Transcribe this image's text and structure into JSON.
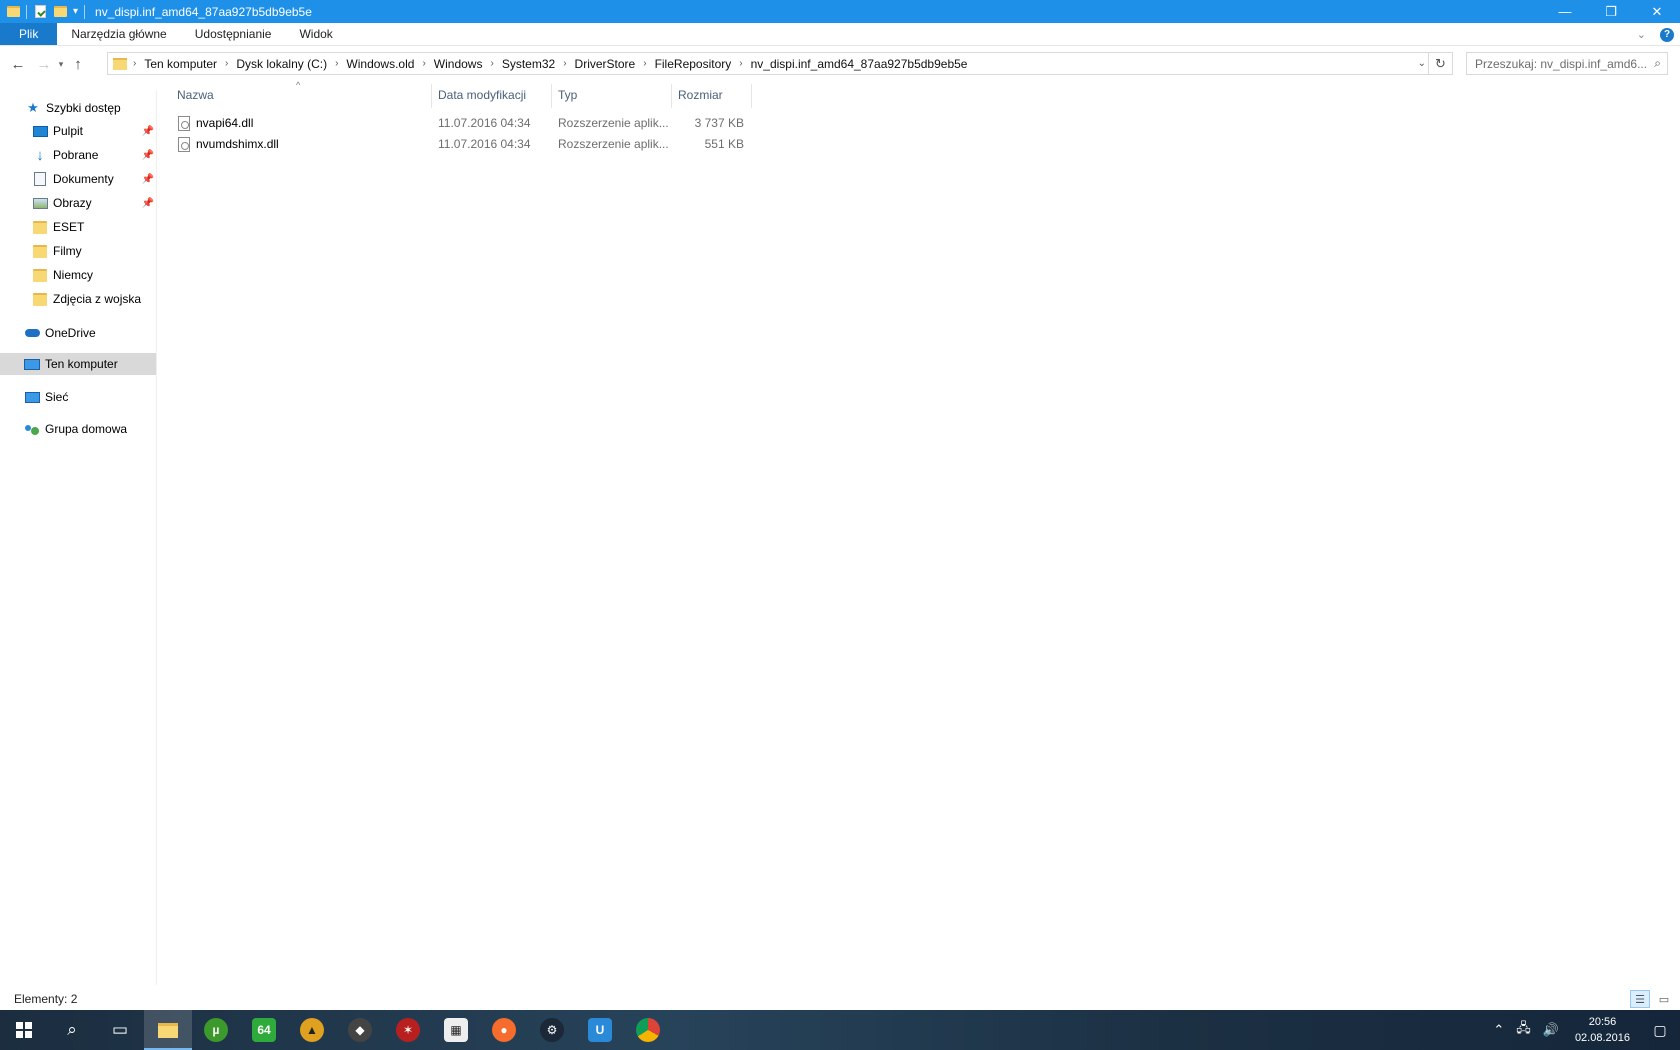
{
  "window": {
    "title": "nv_dispi.inf_amd64_87aa927b5db9eb5e",
    "minimize": "—",
    "restore": "❐",
    "close": "✕"
  },
  "ribbon": {
    "tabs": [
      "Plik",
      "Narzędzia główne",
      "Udostępnianie",
      "Widok"
    ],
    "help": "?"
  },
  "address": {
    "crumbs": [
      "Ten komputer",
      "Dysk lokalny (C:)",
      "Windows.old",
      "Windows",
      "System32",
      "DriverStore",
      "FileRepository",
      "nv_dispi.inf_amd64_87aa927b5db9eb5e"
    ],
    "search_placeholder": "Przeszukaj: nv_dispi.inf_amd6..."
  },
  "sidebar": {
    "quick_access": "Szybki dostęp",
    "items": [
      {
        "label": "Pulpit",
        "icon": "desktop-icon",
        "pinned": true
      },
      {
        "label": "Pobrane",
        "icon": "download-icon",
        "pinned": true
      },
      {
        "label": "Dokumenty",
        "icon": "documents-icon",
        "pinned": true
      },
      {
        "label": "Obrazy",
        "icon": "pictures-icon",
        "pinned": true
      },
      {
        "label": "ESET",
        "icon": "folder-icon",
        "pinned": false
      },
      {
        "label": "Filmy",
        "icon": "folder-icon",
        "pinned": false
      },
      {
        "label": "Niemcy",
        "icon": "folder-icon",
        "pinned": false
      },
      {
        "label": "Zdjęcia z wojska",
        "icon": "folder-icon",
        "pinned": false
      }
    ],
    "onedrive": "OneDrive",
    "this_pc": "Ten komputer",
    "network": "Sieć",
    "homegroup": "Grupa domowa"
  },
  "filelist": {
    "columns": [
      "Nazwa",
      "Data modyfikacji",
      "Typ",
      "Rozmiar"
    ],
    "rows": [
      {
        "name": "nvapi64.dll",
        "date": "11.07.2016 04:34",
        "type": "Rozszerzenie aplik...",
        "size": "3 737 KB"
      },
      {
        "name": "nvumdshimx.dll",
        "date": "11.07.2016 04:34",
        "type": "Rozszerzenie aplik...",
        "size": "551 KB"
      }
    ]
  },
  "status": {
    "items_count": "Elementy: 2"
  },
  "taskbar": {
    "apps": [
      "start-icon",
      "search-icon",
      "task-view-icon",
      "file-explorer-icon",
      "utorrent-icon",
      "64-app-icon",
      "app-icon",
      "app-icon",
      "app-icon",
      "calendar-app-icon",
      "origin-icon",
      "steam-icon",
      "uplay-icon",
      "chrome-icon"
    ],
    "badge_64": "64",
    "time": "20:56",
    "date": "02.08.2016"
  },
  "colors": {
    "titlebar": "#1e90e8",
    "file_tab": "#1979ca",
    "selected_nav": "#d9d9d9"
  }
}
